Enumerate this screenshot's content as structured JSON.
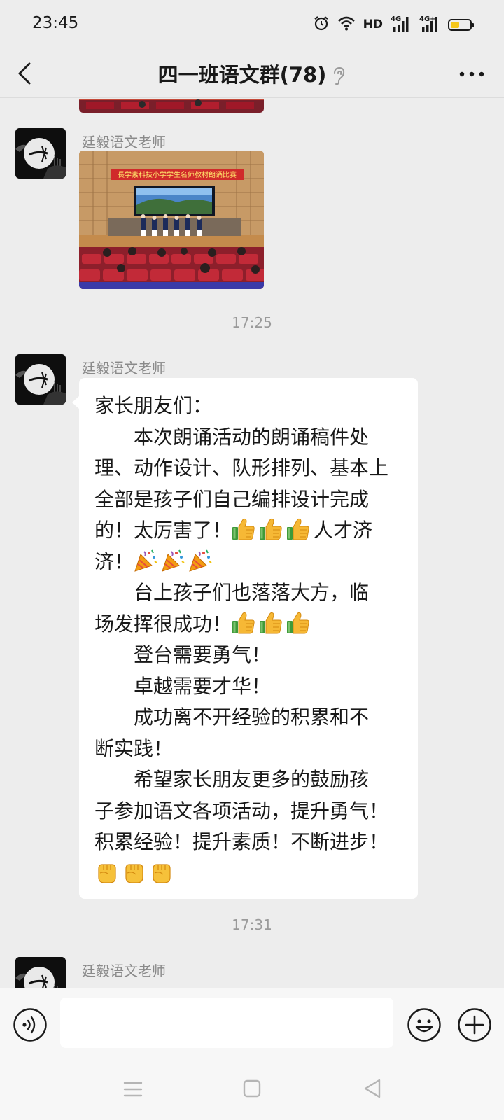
{
  "status_bar": {
    "time": "23:45",
    "hd_label": "HD",
    "net1_label": "4G",
    "net2_label": "4G+",
    "battery_level": 0.45,
    "icons": [
      "alarm-icon",
      "wifi-icon",
      "signal-icon",
      "signal-icon",
      "battery-icon"
    ]
  },
  "header": {
    "title": "四一班语文群(78)",
    "icons": [
      "back-icon",
      "ear-icon",
      "more-icon"
    ]
  },
  "messages": [
    {
      "sender": "廷毅语文老师",
      "type": "image",
      "image_banner": "長学素科技小学学生名师教材朗诵比赛"
    },
    {
      "type": "timestamp",
      "time": "17:25"
    },
    {
      "sender": "廷毅语文老师",
      "type": "text",
      "lines": [
        "家长朋友们：",
        "　　本次朗诵活动的朗诵稿件处",
        "理、动作设计、队形排列、基本上",
        "全部是孩子们自己编排设计完成",
        "的！太厉害了！",
        "人才济",
        "济！",
        "　　台上孩子们也落落大方，临",
        "场发挥很成功！",
        "　　登台需要勇气！",
        "　　卓越需要才华！",
        "　　成功离不开经验的积累和不",
        "断实践！",
        "　　希望家长朋友更多的鼓励孩",
        "子参加语文各项活动，提升勇气！",
        "积累经验！提升素质！不断进步！"
      ],
      "emojis": [
        "thumbs-up-icon",
        "party-popper-icon",
        "thumbs-up-icon",
        "raised-fist-icon"
      ]
    },
    {
      "type": "timestamp",
      "time": "17:31"
    },
    {
      "sender": "廷毅语文老师",
      "type": "partial"
    }
  ],
  "input_bar": {
    "placeholder": "",
    "icons": [
      "voice-icon",
      "emoji-icon",
      "plus-icon"
    ]
  },
  "nav_bar": {
    "icons": [
      "menu-icon",
      "home-icon",
      "back-triangle-icon"
    ]
  },
  "colors": {
    "background": "#ededed",
    "bubble": "#ffffff",
    "battery": "#f4c61b"
  }
}
